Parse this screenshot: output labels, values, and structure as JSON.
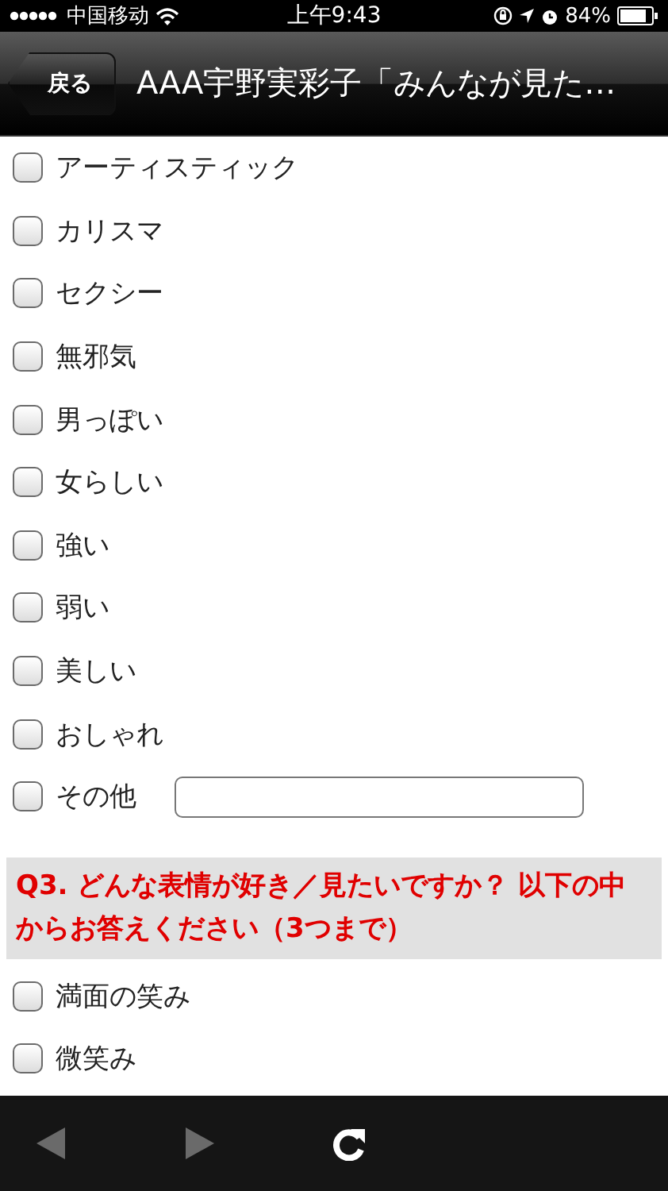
{
  "status_bar": {
    "carrier": "中国移动",
    "time": "上午9:43",
    "battery": "84%"
  },
  "nav_bar": {
    "back_button": "戻る",
    "title": "AAA宇野実彩子「みんなが見た…"
  },
  "options": [
    {
      "kind": "checkbox",
      "label": "アーティスティック",
      "checked": false
    },
    {
      "kind": "checkbox",
      "label": "カリスマ",
      "checked": false
    },
    {
      "kind": "checkbox",
      "label": "セクシー",
      "checked": false
    },
    {
      "kind": "checkbox",
      "label": "無邪気",
      "checked": false
    },
    {
      "kind": "checkbox",
      "label": "男っぽい",
      "checked": false
    },
    {
      "kind": "checkbox",
      "label": "女らしい",
      "checked": false
    },
    {
      "kind": "checkbox",
      "label": "強い",
      "checked": false
    },
    {
      "kind": "checkbox",
      "label": "弱い",
      "checked": false
    },
    {
      "kind": "checkbox",
      "label": "美しい",
      "checked": false
    },
    {
      "kind": "checkbox",
      "label": "おしゃれ",
      "checked": false
    },
    {
      "kind": "checkbox-field",
      "label": "その他",
      "checked": false
    }
  ],
  "question": {
    "text": "Q3. どんな表情が好き／見たいですか？ 以下の中からお答えください（3つまで）"
  },
  "q3_options": [
    {
      "kind": "checkbox",
      "label": "満面の笑み",
      "checked": false
    },
    {
      "kind": "checkbox",
      "label": "微笑み",
      "checked": false
    }
  ],
  "toolbar": [
    {
      "kind": "back",
      "disabled": true
    },
    {
      "kind": "forward",
      "disabled": true
    },
    {
      "kind": "reload",
      "disabled": false
    }
  ]
}
